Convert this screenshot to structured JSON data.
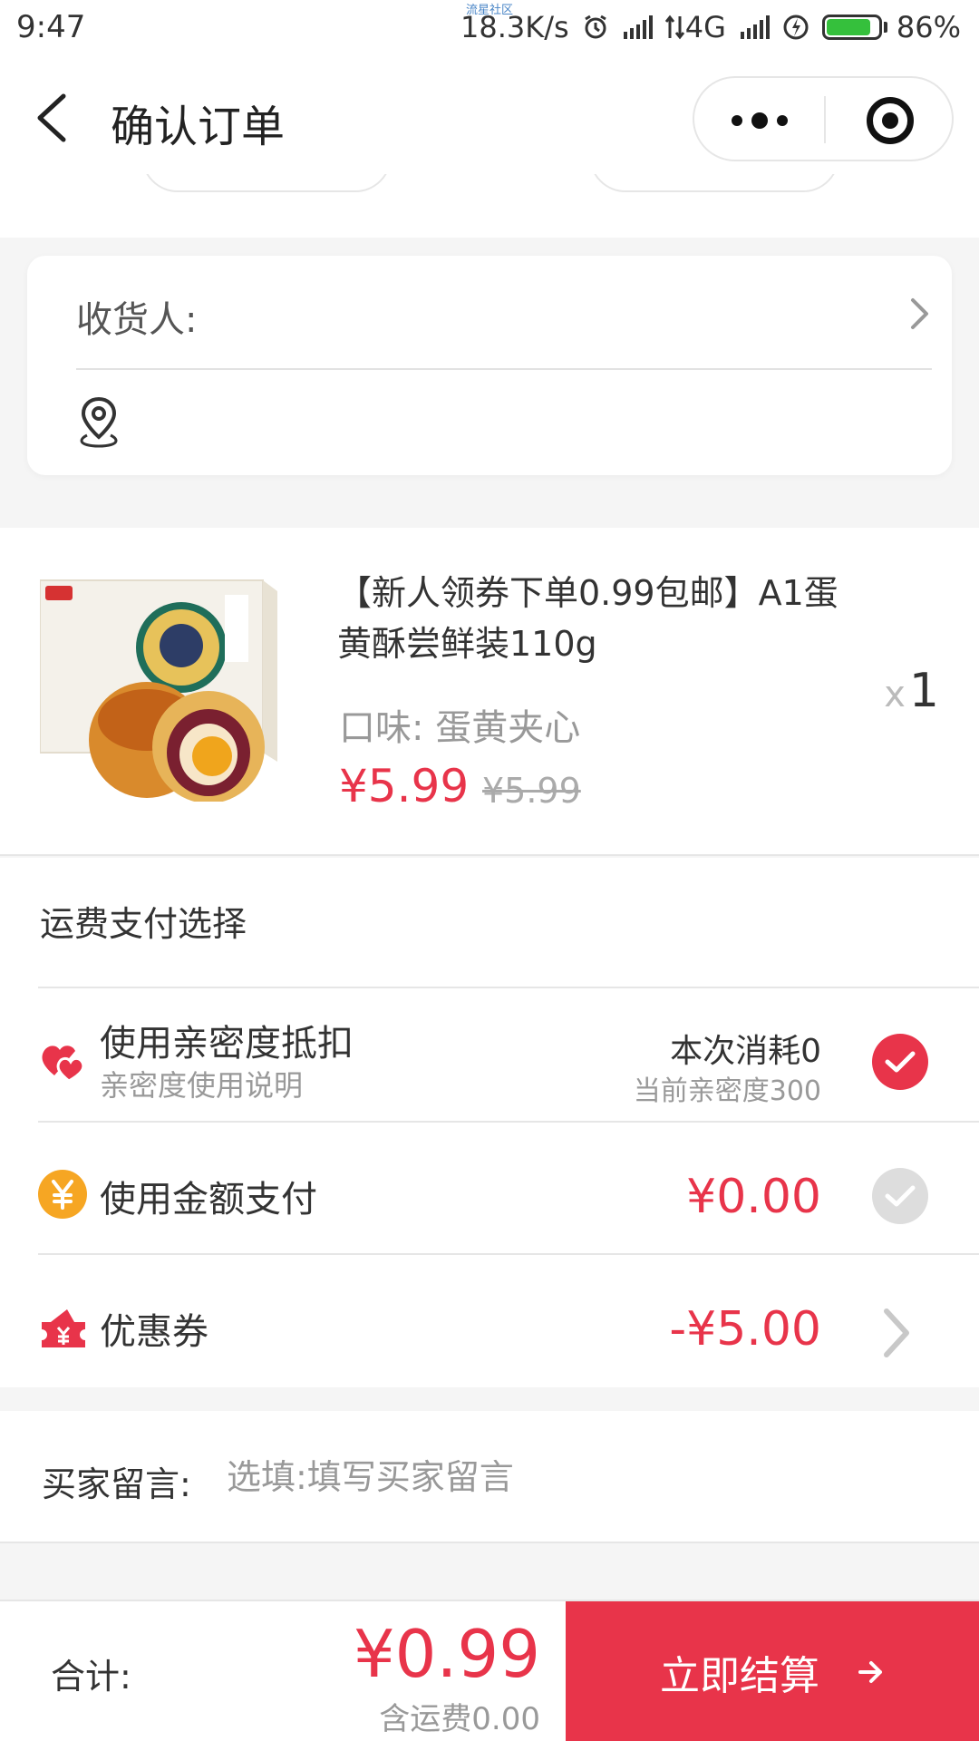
{
  "status_bar": {
    "time": "9:47",
    "carrier_tag": "流星社区",
    "speed": "18.3K/s",
    "network": "4G",
    "battery": "86%",
    "battery_level": 0.86
  },
  "nav": {
    "title": "确认订单"
  },
  "address": {
    "receiver_label": "收货人:"
  },
  "product": {
    "title": "【新人领券下单0.99包邮】A1蛋黄酥尝鲜装110g",
    "spec": "口味: 蛋黄夹心",
    "price": "¥5.99",
    "original_price": "¥5.99",
    "qty_prefix": "x",
    "qty": "1"
  },
  "payment": {
    "heading": "运费支付选择",
    "intimacy": {
      "label": "使用亲密度抵扣",
      "sub": "亲密度使用说明",
      "consume": "本次消耗0",
      "current": "当前亲密度300",
      "checked": true
    },
    "balance": {
      "label": "使用金额支付",
      "amount": "¥0.00",
      "checked": false
    },
    "coupon": {
      "label": "优惠券",
      "amount": "-¥5.00"
    }
  },
  "message": {
    "label": "买家留言:",
    "placeholder": "选填:填写买家留言"
  },
  "footer": {
    "total_label": "合计:",
    "total": "¥0.99",
    "shipping": "含运费0.00",
    "checkout_label": "立即结算"
  },
  "colors": {
    "accent": "#e8344a",
    "coin": "#f6a623",
    "battery": "#35c03c"
  }
}
